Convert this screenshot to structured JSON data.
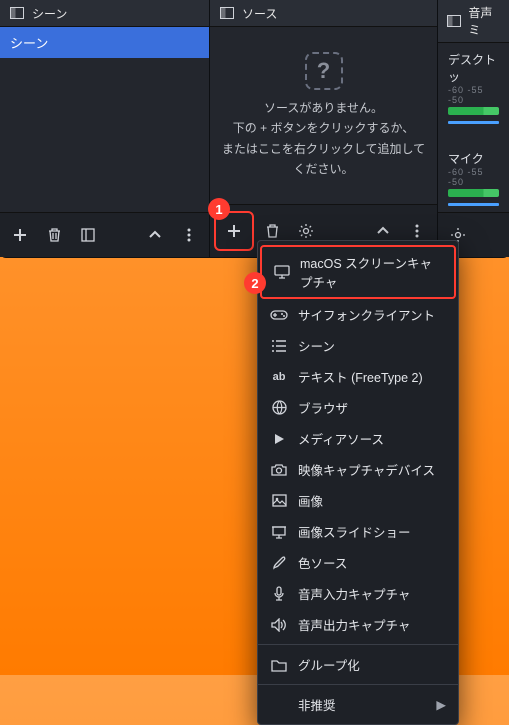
{
  "panels": {
    "scenes": {
      "title": "シーン",
      "items": [
        "シーン"
      ]
    },
    "sources": {
      "title": "ソース",
      "empty": {
        "line1": "ソースがありません。",
        "line2": "下の + ボタンをクリックするか、",
        "line3": "またはここを右クリックして追加してください。"
      }
    },
    "audio": {
      "title": "音声ミ",
      "tracks": [
        {
          "name": "デスクトッ",
          "ticks": "-60  -55  -50"
        },
        {
          "name": "マイク",
          "ticks": "-60  -55  -50"
        }
      ]
    }
  },
  "annotations": {
    "a1": "1",
    "a2": "2"
  },
  "menu": {
    "items": [
      {
        "icon": "monitor-icon",
        "label": "macOS スクリーンキャプチャ",
        "highlighted": true
      },
      {
        "icon": "gamepad-icon",
        "label": "サイフォンクライアント"
      },
      {
        "icon": "list-icon",
        "label": "シーン"
      },
      {
        "icon": "text-icon",
        "label": "テキスト (FreeType 2)"
      },
      {
        "icon": "globe-icon",
        "label": "ブラウザ"
      },
      {
        "icon": "play-icon",
        "label": "メディアソース"
      },
      {
        "icon": "camera-icon",
        "label": "映像キャプチャデバイス"
      },
      {
        "icon": "image-icon",
        "label": "画像"
      },
      {
        "icon": "slideshow-icon",
        "label": "画像スライドショー"
      },
      {
        "icon": "brush-icon",
        "label": "色ソース"
      },
      {
        "icon": "mic-icon",
        "label": "音声入力キャプチャ"
      },
      {
        "icon": "speaker-icon",
        "label": "音声出力キャプチャ"
      }
    ],
    "group": {
      "icon": "folder-icon",
      "label": "グループ化"
    },
    "deprecated": "非推奨"
  }
}
